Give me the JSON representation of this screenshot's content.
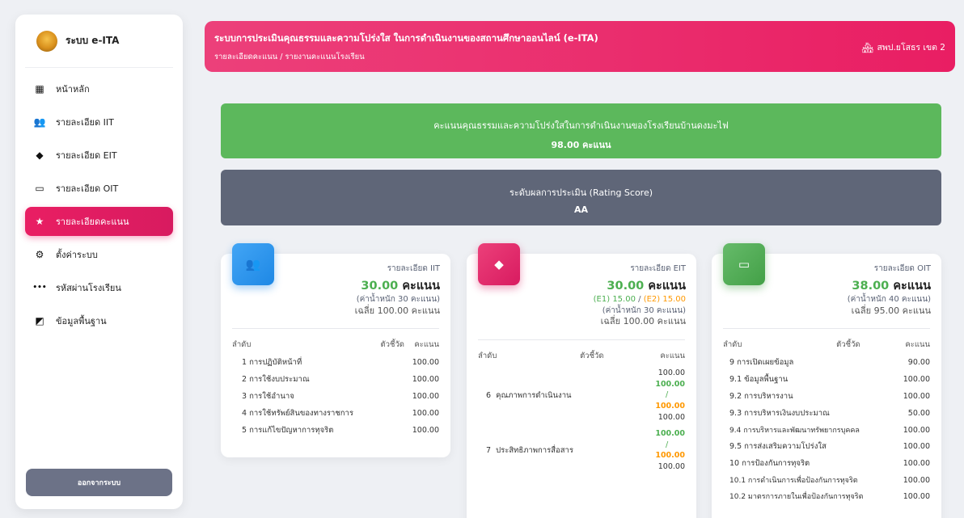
{
  "brand": {
    "title": "ระบบ e-ITA"
  },
  "nav": [
    {
      "label": "หน้าหลัก",
      "icon": "dashboard-icon",
      "glyph": "▦"
    },
    {
      "label": "รายละเอียด IIT",
      "icon": "users-icon",
      "glyph": "👥"
    },
    {
      "label": "รายละเอียด EIT",
      "icon": "diamond-icon",
      "glyph": "◆"
    },
    {
      "label": "รายละเอียด OIT",
      "icon": "devices-icon",
      "glyph": "▭"
    },
    {
      "label": "รายละเอียดคะแนน",
      "icon": "star-icon",
      "glyph": "★"
    },
    {
      "label": "ตั้งค่าระบบ",
      "icon": "gear-icon",
      "glyph": "⚙"
    },
    {
      "label": "รหัสผ่านโรงเรียน",
      "icon": "password-icon",
      "glyph": "•••"
    },
    {
      "label": "ข้อมูลพื้นฐาน",
      "icon": "chart-icon",
      "glyph": "◩"
    }
  ],
  "logout": "ออกจากระบบ",
  "header": {
    "title": "ระบบการประเมินคุณธรรมและความโปร่งใส ในการดำเนินงานของสถานศึกษาออนไลน์ (e-ITA)",
    "breadcrumb": "รายละเอียดคะแนน / รายงานคะแนนโรงเรียน",
    "org": "สพป.ยโสธร เขต 2"
  },
  "banner_score": {
    "line1": "คะแนนคุณธรรมและความโปร่งใสในการดำเนินงานของโรงเรียนบ้านดงมะไฟ",
    "line2": "98.00 คะแนน"
  },
  "banner_rating": {
    "line1": "ระดับผลการประเมิน (Rating Score)",
    "line2": "AA"
  },
  "iit": {
    "title": "รายละเอียด IIT",
    "score": "30.00",
    "unit": "คะแนน",
    "weight": "(ค่าน้ำหนัก 30 คะแนน)",
    "avg": "เฉลี่ย 100.00 คะแนน",
    "cols": [
      "ลำดับ",
      "ตัวชี้วัด",
      "คะแนน"
    ],
    "rows": [
      [
        "1",
        "การปฏิบัติหน้าที่",
        "100.00"
      ],
      [
        "2",
        "การใช้งบประมาณ",
        "100.00"
      ],
      [
        "3",
        "การใช้อำนาจ",
        "100.00"
      ],
      [
        "4",
        "การใช้ทรัพย์สินของทางราชการ",
        "100.00"
      ],
      [
        "5",
        "การแก้ไขปัญหาการทุจริต",
        "100.00"
      ]
    ]
  },
  "eit": {
    "title": "รายละเอียด EIT",
    "score": "30.00",
    "unit": "คะแนน",
    "e1": "(E1) 15.00",
    "sep": "/",
    "e2": "(E2) 15.00",
    "weight": "(ค่าน้ำหนัก 30 คะแนน)",
    "avg": "เฉลี่ย 100.00 คะแนน",
    "cols": [
      "ลำดับ",
      "ตัวชี้วัด",
      "คะแนน"
    ],
    "rows": [
      {
        "no": "6",
        "name": "คุณภาพการดำเนินงาน",
        "v1": "100.00",
        "v2": "100.00",
        "slash": "/",
        "v3": "100.00",
        "v4": "100.00"
      },
      {
        "no": "7",
        "name": "ประสิทธิภาพการสื่อสาร",
        "v1": "100.00",
        "v2": "100.00",
        "slash": "/",
        "v3": "100.00",
        "v4": "100.00"
      }
    ]
  },
  "oit": {
    "title": "รายละเอียด OIT",
    "score": "38.00",
    "unit": "คะแนน",
    "weight": "(ค่าน้ำหนัก 40 คะแนน)",
    "avg": "เฉลี่ย 95.00 คะแนน",
    "cols": [
      "ลำดับ",
      "ตัวชี้วัด",
      "คะแนน"
    ],
    "rows": [
      [
        "9",
        "การเปิดเผยข้อมูล",
        "90.00"
      ],
      [
        "9.1",
        "ข้อมูลพื้นฐาน",
        "100.00"
      ],
      [
        "9.2",
        "การบริหารงาน",
        "100.00"
      ],
      [
        "9.3",
        "การบริหารเงินงบประมาณ",
        "50.00"
      ],
      [
        "9.4",
        "การบริหารและพัฒนาทรัพยากรบุคคล",
        "100.00"
      ],
      [
        "9.5",
        "การส่งเสริมความโปร่งใส",
        "100.00"
      ],
      [
        "10",
        "การป้องกันการทุจริต",
        "100.00"
      ],
      [
        "10.1",
        "การดำเนินการเพื่อป้องกันการทุจริต",
        "100.00"
      ],
      [
        "10.2",
        "มาตรการภายในเพื่อป้องกันการทุจริต",
        "100.00"
      ]
    ]
  }
}
